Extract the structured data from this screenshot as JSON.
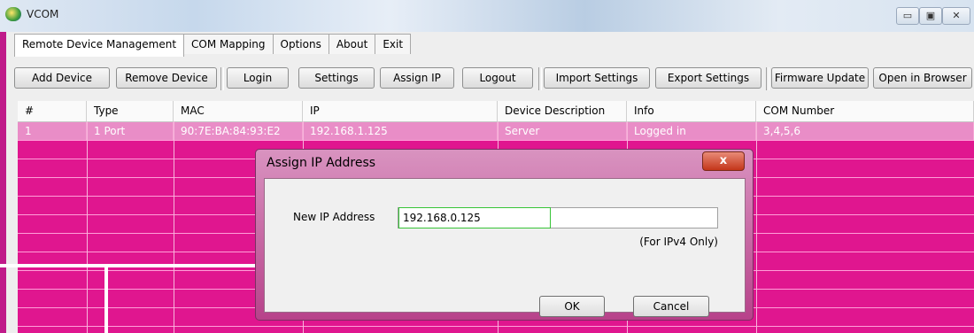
{
  "window": {
    "title": "VCOM",
    "controls": {
      "minimize": "▭",
      "maximize": "▣",
      "close": "✕"
    }
  },
  "tabs": [
    {
      "label": "Remote Device Management",
      "active": true
    },
    {
      "label": "COM Mapping",
      "active": false
    },
    {
      "label": "Options",
      "active": false
    },
    {
      "label": "About",
      "active": false
    },
    {
      "label": "Exit",
      "active": false
    }
  ],
  "toolbar": {
    "add_device": "Add Device",
    "remove_device": "Remove Device",
    "login": "Login",
    "settings": "Settings",
    "assign_ip": "Assign IP",
    "logout": "Logout",
    "import_settings": "Import Settings",
    "export_settings": "Export Settings",
    "firmware_update": "Firmware Update",
    "open_in_browser": "Open in Browser"
  },
  "table": {
    "columns": [
      "#",
      "Type",
      "MAC",
      "IP",
      "Device Description",
      "Info",
      "COM Number"
    ],
    "rows": [
      [
        "1",
        "1 Port",
        "90:7E:BA:84:93:E2",
        "192.168.1.125",
        "Server",
        "Logged in",
        "3,4,5,6"
      ]
    ]
  },
  "dialog": {
    "title": "Assign IP Address",
    "close": "x",
    "label": "New IP Address",
    "value": "192.168.0.125",
    "note": "(For IPv4 Only)",
    "ok": "OK",
    "cancel": "Cancel"
  },
  "colors": {
    "grid_background": "#e0168f",
    "selected_row": "#e98dc7"
  }
}
